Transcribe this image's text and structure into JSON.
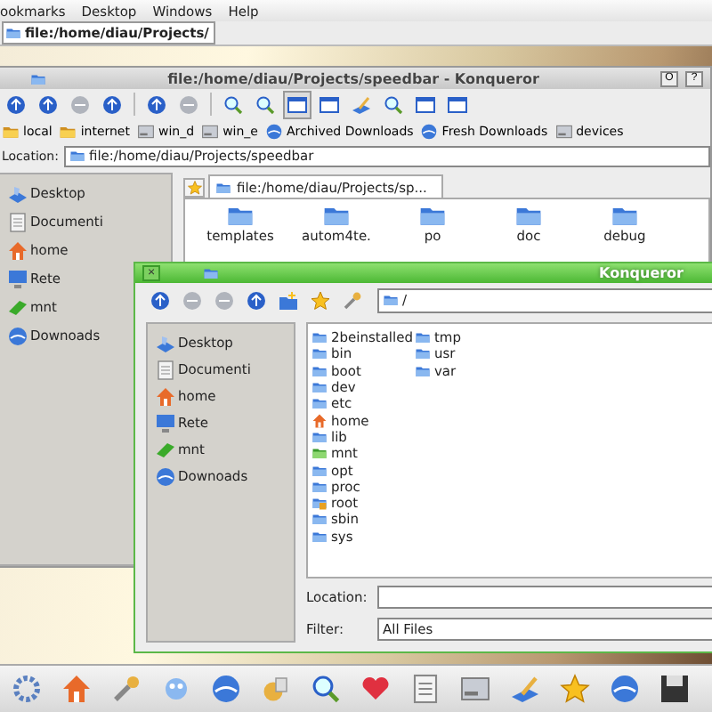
{
  "menu_bar": {
    "items": [
      "ookmarks",
      "Desktop",
      "Windows",
      "Help"
    ]
  },
  "taskbar": {
    "tasks": [
      {
        "label": "file:/home/diau/Projects/",
        "selected": true
      }
    ]
  },
  "main_window": {
    "title": "file:/home/diau/Projects/speedbar - Konqueror",
    "title_buttons": [
      "O",
      "?"
    ],
    "bookmarks": [
      {
        "label": "local"
      },
      {
        "label": "internet"
      },
      {
        "label": "win_d"
      },
      {
        "label": "win_e"
      },
      {
        "label": "Archived Downloads"
      },
      {
        "label": "Fresh Downloads"
      },
      {
        "label": "devices"
      }
    ],
    "location": {
      "label": "Location:",
      "value": "file:/home/diau/Projects/speedbar"
    },
    "sidebar": {
      "items": [
        "Desktop",
        "Documenti",
        "home",
        "Rete",
        "mnt",
        "Downoads"
      ]
    },
    "tabs": [
      {
        "label": "file:/home/diau/Projects/sp...",
        "selected": true
      }
    ],
    "files": [
      "templates",
      "autom4te.",
      "po",
      "doc",
      "debug"
    ]
  },
  "dialog": {
    "title": "Konqueror",
    "close": "×",
    "path": "/",
    "sidebar": {
      "items": [
        "Desktop",
        "Documenti",
        "home",
        "Rete",
        "mnt",
        "Downoads"
      ]
    },
    "files": [
      "2beinstalled",
      "bin",
      "boot",
      "dev",
      "etc",
      "home",
      "lib",
      "mnt",
      "opt",
      "proc",
      "root",
      "sbin",
      "sys",
      "tmp",
      "usr",
      "var"
    ],
    "location": {
      "label": "Location:"
    },
    "filter": {
      "label": "Filter:",
      "value": "All Files"
    }
  }
}
